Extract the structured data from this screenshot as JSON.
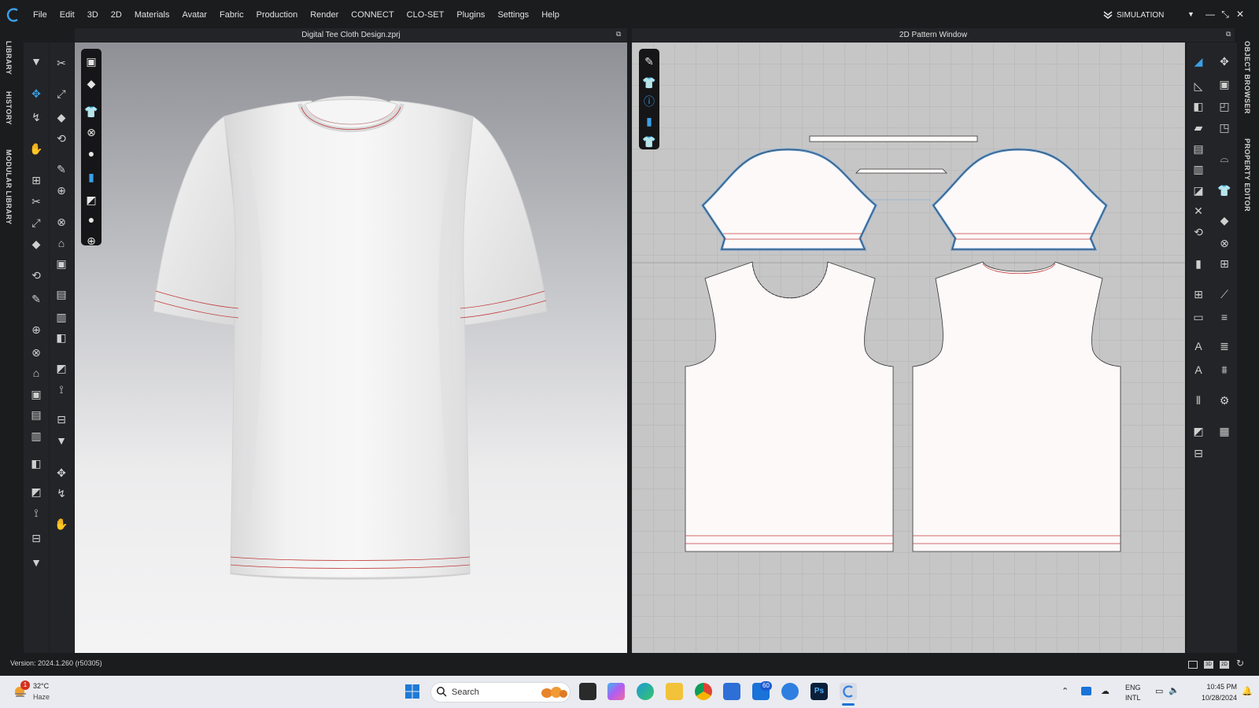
{
  "menu": {
    "items": [
      "File",
      "Edit",
      "3D",
      "2D",
      "Materials",
      "Avatar",
      "Fabric",
      "Production",
      "Render",
      "CONNECT",
      "CLO-SET",
      "Plugins",
      "Settings",
      "Help"
    ],
    "mode_label": "SIMULATION"
  },
  "left_tabs": [
    "LIBRARY",
    "HISTORY",
    "MODULAR LIBRARY"
  ],
  "right_tabs": [
    "OBJECT BROWSER",
    "PROPERTY EDITOR"
  ],
  "window3d": {
    "title": "Digital Tee Cloth Design.zprj"
  },
  "window2d": {
    "title": "2D Pattern Window"
  },
  "status": {
    "version": "Version: 2024.1.260 (r50305)"
  },
  "taskbar": {
    "weather_temp": "32°C",
    "weather_desc": "Haze",
    "weather_badge": "1",
    "search_placeholder": "Search",
    "mail_badge": "60",
    "lang_line1": "ENG",
    "lang_line2": "INTL",
    "time": "10:45 PM",
    "date": "10/28/2024"
  },
  "colors": {
    "accent": "#3aa0e8",
    "seam_red": "#c23b3b",
    "pattern_fill": "#fdf9f9",
    "selected_outline": "#5b9ad6"
  }
}
